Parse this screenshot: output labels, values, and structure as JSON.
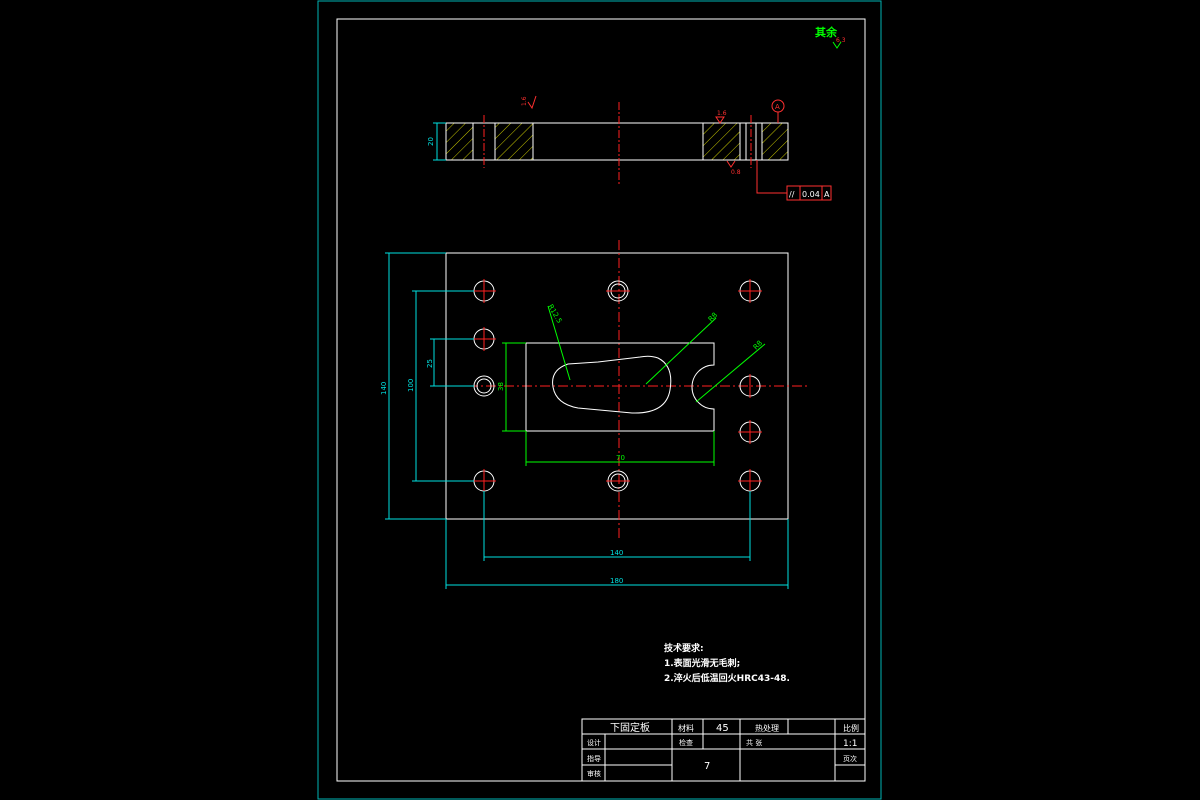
{
  "corner_mark": {
    "text": "其余",
    "roughness": "6.3"
  },
  "side_view": {
    "thickness_dim": "20",
    "roughness_left": "1.6",
    "roughness_right_top": "1.6",
    "roughness_right_bottom": "0.8",
    "datum_letter": "A",
    "tolerance_symbol": "//",
    "tolerance_value": "0.04",
    "tolerance_datum": "A"
  },
  "plan_view": {
    "dim_height_overall": "140",
    "dim_height_holes": "100",
    "dim_small": "25",
    "dim_slot_height": "38",
    "dim_width_slot": "70",
    "dim_width_holes": "140",
    "dim_width_overall": "180",
    "radius_1": "R12.5",
    "radius_2": "R8",
    "radius_3": "R8"
  },
  "notes": {
    "title": "技术要求:",
    "line1": "1.表面光滑无毛刺;",
    "line2": "2.淬火后低温回火HRC43-48."
  },
  "title_block": {
    "part_name": "下固定板",
    "material_label": "材料",
    "material_value": "45",
    "heat_label": "热处理",
    "scale_label": "比例",
    "scale_value": "1:1",
    "design_label": "设计",
    "check_label": "检查",
    "count_label": "共 张",
    "guide_label": "指导",
    "sheet_number": "7",
    "sheet_label": "页次",
    "review_label": "审核"
  }
}
